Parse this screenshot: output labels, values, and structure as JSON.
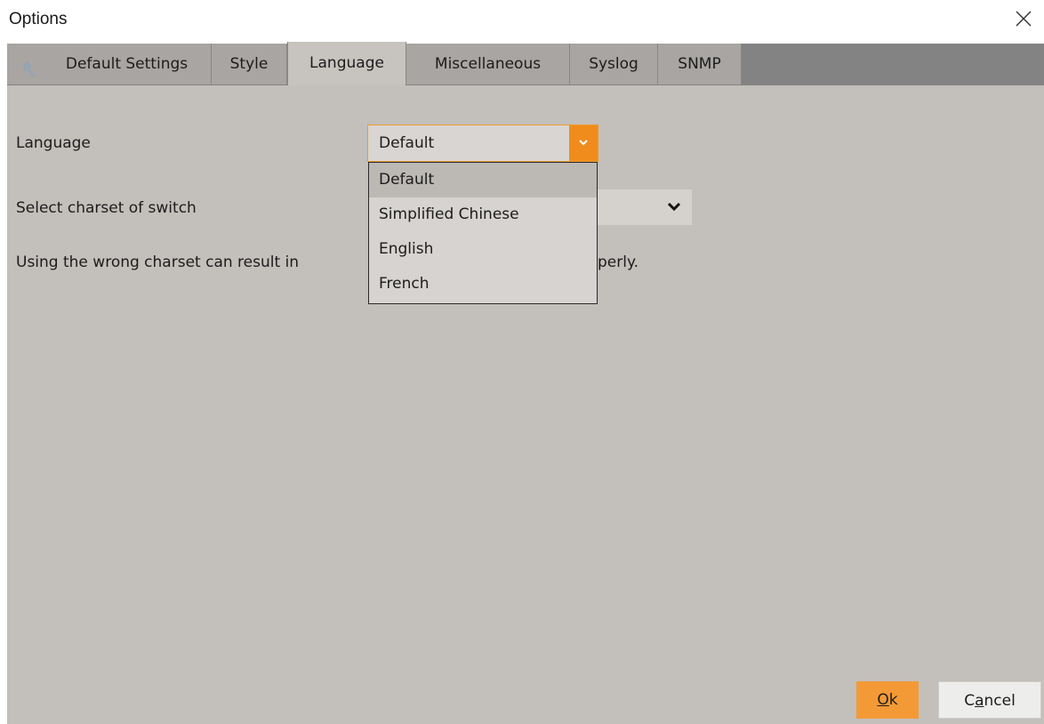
{
  "window": {
    "title": "Options"
  },
  "tabs": [
    {
      "label": "Default Settings",
      "icon": "wrench-icon",
      "active": false
    },
    {
      "label": "Style",
      "active": false
    },
    {
      "label": "Language",
      "active": true
    },
    {
      "label": "Miscellaneous",
      "active": false
    },
    {
      "label": "Syslog",
      "active": false
    },
    {
      "label": "SNMP",
      "active": false
    }
  ],
  "language": {
    "label": "Language",
    "selected": "Default",
    "options": [
      "Default",
      "Simplified Chinese",
      "English",
      "French"
    ]
  },
  "charset": {
    "label": "Select charset of switch",
    "warning_prefix": "Using the wrong charset can result in ",
    "warning_suffix": "perly."
  },
  "buttons": {
    "ok_mnemonic": "O",
    "ok_rest": "k",
    "cancel_pre": "C",
    "cancel_mnemonic": "a",
    "cancel_rest": "ncel"
  },
  "colors": {
    "accent": "#f08c1c",
    "panel": "#c3bfbb",
    "tabstrip": "#838383"
  }
}
